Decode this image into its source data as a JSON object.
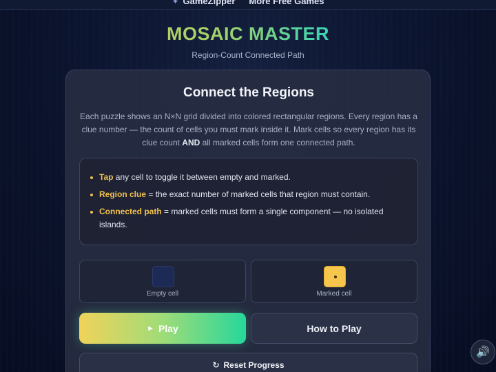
{
  "topbar": {
    "brand_icon": "puzzle-icon",
    "brand": "GameZipper",
    "more_link": "More Free Games"
  },
  "header": {
    "title": "MOSAIC MASTER",
    "subtitle": "Region-Count Connected Path"
  },
  "card": {
    "title": "Connect the Regions",
    "description_pre": "Each puzzle shows an N×N grid divided into colored rectangular regions. Every region has a clue number — the count of cells you must mark inside it. Mark cells so every region has its clue count ",
    "description_strong": "AND",
    "description_post": " all marked cells form one connected path.",
    "rules": [
      {
        "key": "Tap",
        "text": " any cell to toggle it between empty and marked."
      },
      {
        "key": "Region clue",
        "text": " = the exact number of marked cells that region must contain."
      },
      {
        "key": "Connected path",
        "text": " = marked cells must form a single component — no isolated islands."
      }
    ],
    "legend": {
      "empty_label": "Empty cell",
      "marked_label": "Marked cell"
    },
    "buttons": {
      "play_icon": "play-icon",
      "play_glyph": "►",
      "play": "Play",
      "how_to_play": "How to Play",
      "reset_glyph": "↻",
      "reset": "Reset Progress"
    }
  },
  "sound": {
    "icon": "speaker-icon",
    "glyph": "🔊"
  },
  "colors": {
    "accent_yellow": "#f2c14e",
    "accent_green": "#27d79b",
    "empty_cell": "#1c2a55",
    "marked_cell": "#f5c54c"
  }
}
